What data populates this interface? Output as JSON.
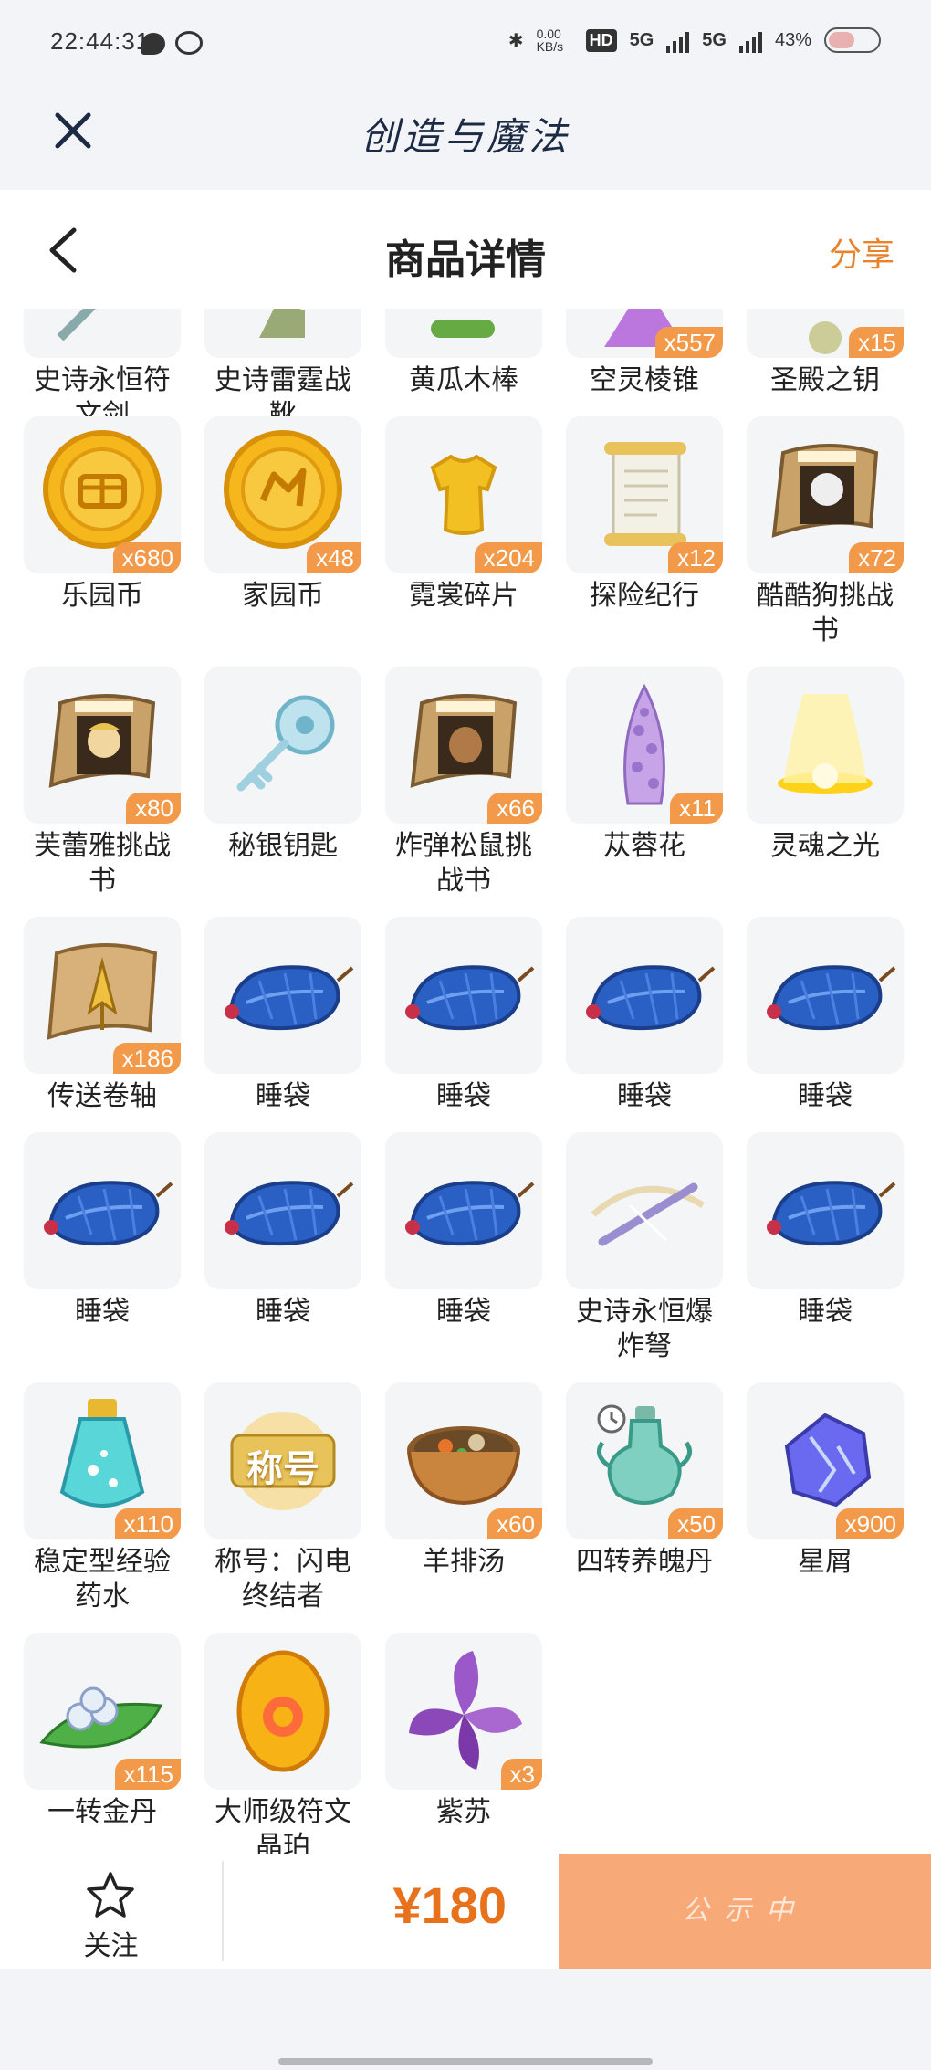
{
  "status_bar": {
    "time": "22:44:31",
    "net_speed": "0.00 KB/s",
    "hd_badge": "HD",
    "network_1": "5G",
    "network_2": "5G",
    "battery": "43%"
  },
  "app_header": {
    "title": "创造与魔法",
    "close_icon": "close-icon"
  },
  "nav": {
    "title": "商品详情",
    "share_label": "分享",
    "back_icon": "chevron-left-icon"
  },
  "colors": {
    "accent": "#e8822c",
    "badge": "#f29a4a",
    "price": "#e8711c",
    "status_button": "#f8a978"
  },
  "items": [
    {
      "name": "史诗永恒符文剑",
      "qty": "",
      "icon": "epic-rune-sword-icon"
    },
    {
      "name": "史诗雷霆战靴",
      "qty": "",
      "icon": "epic-thunder-boots-icon"
    },
    {
      "name": "黄瓜木棒",
      "qty": "",
      "icon": "cucumber-stick-icon"
    },
    {
      "name": "空灵棱锥",
      "qty": "x557",
      "icon": "ethereal-pyramid-icon"
    },
    {
      "name": "圣殿之钥",
      "qty": "x15",
      "icon": "temple-key-icon"
    },
    {
      "name": "乐园币",
      "qty": "x680",
      "icon": "paradise-coin-icon"
    },
    {
      "name": "家园币",
      "qty": "x48",
      "icon": "home-coin-icon"
    },
    {
      "name": "霓裳碎片",
      "qty": "x204",
      "icon": "dress-fragment-icon"
    },
    {
      "name": "探险纪行",
      "qty": "x12",
      "icon": "scroll-icon"
    },
    {
      "name": "酷酷狗挑战书",
      "qty": "x72",
      "icon": "wanted-poster-dog-icon"
    },
    {
      "name": "芙蕾雅挑战书",
      "qty": "x80",
      "icon": "wanted-poster-freya-icon"
    },
    {
      "name": "秘银钥匙",
      "qty": "",
      "icon": "mithril-key-icon"
    },
    {
      "name": "炸弹松鼠挑战书",
      "qty": "x66",
      "icon": "wanted-poster-squirrel-icon"
    },
    {
      "name": "苁蓉花",
      "qty": "x11",
      "icon": "cistanche-flower-icon"
    },
    {
      "name": "灵魂之光",
      "qty": "",
      "icon": "soul-light-icon"
    },
    {
      "name": "传送卷轴",
      "qty": "x186",
      "icon": "teleport-scroll-icon"
    },
    {
      "name": "睡袋",
      "qty": "",
      "icon": "sleeping-bag-icon"
    },
    {
      "name": "睡袋",
      "qty": "",
      "icon": "sleeping-bag-icon"
    },
    {
      "name": "睡袋",
      "qty": "",
      "icon": "sleeping-bag-icon"
    },
    {
      "name": "睡袋",
      "qty": "",
      "icon": "sleeping-bag-icon"
    },
    {
      "name": "睡袋",
      "qty": "",
      "icon": "sleeping-bag-icon"
    },
    {
      "name": "睡袋",
      "qty": "",
      "icon": "sleeping-bag-icon"
    },
    {
      "name": "睡袋",
      "qty": "",
      "icon": "sleeping-bag-icon"
    },
    {
      "name": "史诗永恒爆炸弩",
      "qty": "",
      "icon": "epic-crossbow-icon"
    },
    {
      "name": "睡袋",
      "qty": "",
      "icon": "sleeping-bag-icon"
    },
    {
      "name": "稳定型经验药水",
      "qty": "x110",
      "icon": "exp-potion-icon"
    },
    {
      "name": "称号：闪电终结者",
      "qty": "",
      "icon": "title-badge-icon",
      "badge_text": "称号"
    },
    {
      "name": "羊排汤",
      "qty": "x60",
      "icon": "lamb-soup-icon"
    },
    {
      "name": "四转养魄丹",
      "qty": "x50",
      "icon": "elixir-vase-icon"
    },
    {
      "name": "星屑",
      "qty": "x900",
      "icon": "stardust-icon"
    },
    {
      "name": "一转金丹",
      "qty": "x115",
      "icon": "golden-pill-icon"
    },
    {
      "name": "大师级符文晶珀",
      "qty": "",
      "icon": "rune-amber-icon"
    },
    {
      "name": "紫苏",
      "qty": "x3",
      "icon": "perilla-leaf-icon"
    }
  ],
  "bottom_bar": {
    "follow_label": "关注",
    "follow_icon": "star-outline-icon",
    "price": "¥180",
    "status_label": "公示中"
  }
}
